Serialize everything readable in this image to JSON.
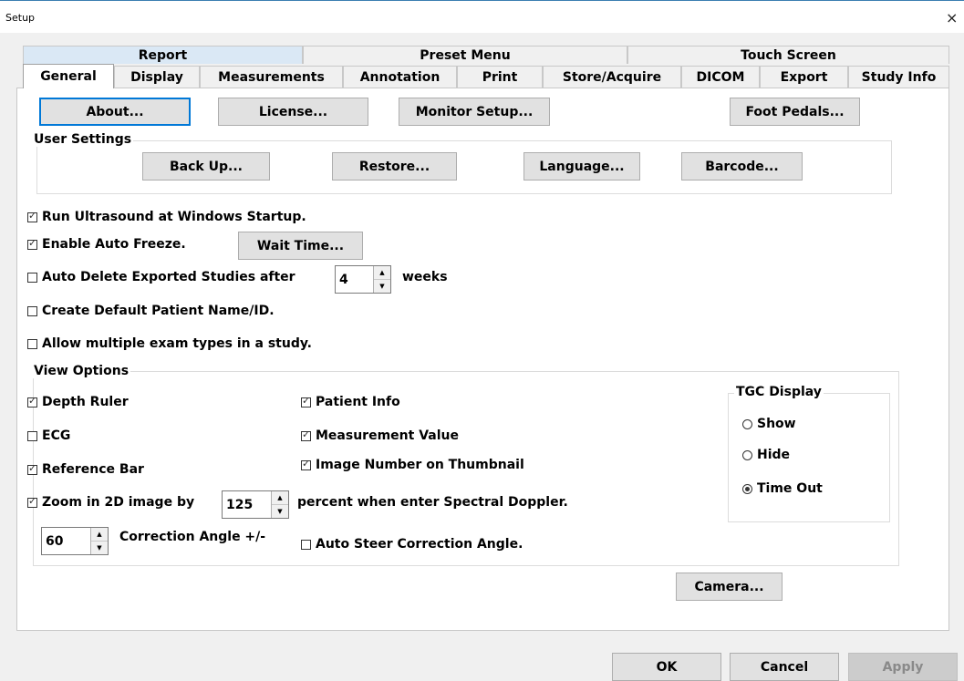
{
  "window": {
    "title": "Setup",
    "close_glyph": "×"
  },
  "tabs": {
    "upper": [
      "Report",
      "Preset Menu",
      "Touch Screen"
    ],
    "lower": [
      "General",
      "Display",
      "Measurements",
      "Annotation",
      "Print",
      "Store/Acquire",
      "DICOM",
      "Export",
      "Study Info"
    ],
    "active": "General"
  },
  "top_buttons": {
    "about": "About...",
    "license": "License...",
    "monitor_setup": "Monitor Setup...",
    "foot_pedals": "Foot Pedals..."
  },
  "user_settings": {
    "label": "User Settings",
    "back_up": "Back Up...",
    "restore": "Restore...",
    "language": "Language...",
    "barcode": "Barcode..."
  },
  "options": {
    "run_at_startup": {
      "label": "Run Ultrasound at Windows Startup.",
      "checked": true
    },
    "auto_freeze": {
      "label": "Enable Auto Freeze.",
      "checked": true
    },
    "wait_time": "Wait Time...",
    "auto_delete": {
      "label": "Auto Delete Exported Studies after",
      "checked": false,
      "value": "4",
      "suffix": "weeks"
    },
    "default_patient": {
      "label": "Create Default Patient Name/ID.",
      "checked": false
    },
    "multiple_exam": {
      "label": "Allow multiple exam types in a study.",
      "checked": false
    }
  },
  "view_options": {
    "label": "View Options",
    "depth_ruler": {
      "label": "Depth Ruler",
      "checked": true
    },
    "ecg": {
      "label": "ECG",
      "checked": false
    },
    "reference_bar": {
      "label": "Reference Bar",
      "checked": true
    },
    "patient_info": {
      "label": "Patient Info",
      "checked": true
    },
    "measurement_value": {
      "label": "Measurement Value",
      "checked": true
    },
    "image_number": {
      "label": "Image Number on Thumbnail",
      "checked": true
    },
    "zoom": {
      "label": "Zoom in 2D image by",
      "checked": true,
      "value": "125",
      "suffix": "percent when enter Spectral Doppler."
    },
    "correction_angle": {
      "value": "60",
      "label": "Correction Angle +/-"
    },
    "auto_steer": {
      "label": "Auto Steer Correction Angle.",
      "checked": false
    },
    "tgc": {
      "label": "TGC Display",
      "options": [
        "Show",
        "Hide",
        "Time Out"
      ],
      "selected": "Time Out"
    }
  },
  "camera": "Camera...",
  "footer": {
    "ok": "OK",
    "cancel": "Cancel",
    "apply": "Apply"
  },
  "colors": {
    "focus": "#0078d7",
    "tab_highlight": "#dae8f5"
  }
}
